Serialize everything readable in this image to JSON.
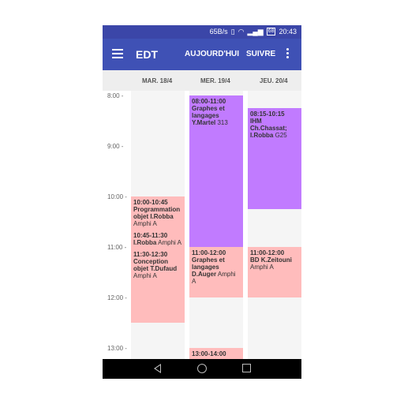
{
  "statusbar": {
    "speed": "65B/s",
    "battery": "68",
    "time": "20:43"
  },
  "appbar": {
    "title": "EDT",
    "today_label": "AUJOURD'HUI",
    "next_label": "SUIVRE"
  },
  "days": [
    "MAR. 18/4",
    "MER. 19/4",
    "JEU. 20/4"
  ],
  "hours": [
    "8:00 -",
    "9:00 -",
    "10:00 -",
    "11:00 -",
    "12:00 -",
    "13:00 -"
  ],
  "events": {
    "tue_block": [
      {
        "time": "10:00-10:45",
        "title": "Programmation objet I.Robba",
        "room": "Amphi  A"
      },
      {
        "time": "10:45-11:30",
        "title": "I.Robba",
        "room": "Amphi A"
      },
      {
        "time": "11:30-12:30",
        "title": "Conception objet T.Dufaud",
        "room": "Amphi  A"
      }
    ],
    "wed_1": {
      "time": "08:00-11:00",
      "title": "Graphes et langages Y.Martel",
      "room": "313"
    },
    "wed_2": {
      "time": "11:00-12:00",
      "title": "Graphes et langages D.Auger",
      "room": "Amphi A"
    },
    "wed_3": {
      "time": "13:00-14:00"
    },
    "thu_1": {
      "time": "08:15-10:15",
      "title": "IHM Ch.Chassat; I.Robba",
      "room": "G25"
    },
    "thu_2": {
      "time": "11:00-12:00",
      "title": "BD K.Zeitouni",
      "room": "Amphi  A"
    }
  },
  "colors": {
    "appbar": "#3f51b5",
    "statusbar": "#3b46a8",
    "event_pink": "#ffbcbc",
    "event_purple": "#c17bff"
  }
}
